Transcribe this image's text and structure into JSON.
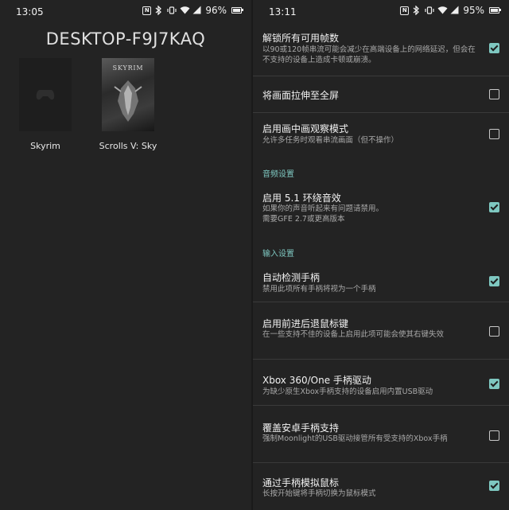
{
  "left_screen": {
    "status": {
      "time": "13:05",
      "battery": "96%",
      "battery_fraction": 0.96
    },
    "pc_name": "DESKTOP-F9J7KAQ",
    "games": [
      {
        "label": "Skyrim",
        "cover_icon": "gamepad-icon"
      },
      {
        "label": "Scrolls V: Sky",
        "cover_text": "SKYRIM"
      }
    ]
  },
  "right_screen": {
    "status": {
      "time": "13:11",
      "battery": "95%",
      "battery_fraction": 0.95
    },
    "settings": [
      {
        "title": "解锁所有可用帧数",
        "desc": "以90或120帧串流可能会减少在高端设备上的网络延迟，但会在不支持的设备上造成卡顿或崩溃。",
        "checked": true
      },
      {
        "title": "将画面拉伸至全屏",
        "desc": "",
        "checked": false
      },
      {
        "title": "启用画中画观察模式",
        "desc": "允许多任务时观看串流画面（但不操作）",
        "checked": false
      },
      {
        "section": "音频设置"
      },
      {
        "title": "启用 5.1 环绕音效",
        "desc": "如果你的声音听起来有问题请禁用。\n需要GFE 2.7或更高版本",
        "checked": true
      },
      {
        "section": "输入设置"
      },
      {
        "title": "自动检测手柄",
        "desc": "禁用此项所有手柄将视为一个手柄",
        "checked": true
      },
      {
        "title": "启用前进后退鼠标键",
        "desc": "在一些支持不佳的设备上启用此项可能会使其右键失效",
        "checked": false
      },
      {
        "title": "Xbox 360/One 手柄驱动",
        "desc": "为缺少原生Xbox手柄支持的设备启用内置USB驱动",
        "checked": true
      },
      {
        "title": "覆盖安卓手柄支持",
        "desc": "强制Moonlight的USB驱动接管所有受支持的Xbox手柄",
        "checked": false
      },
      {
        "title": "通过手柄模拟鼠标",
        "desc": "长按开始键将手柄切换为鼠标模式",
        "checked": true
      }
    ]
  }
}
